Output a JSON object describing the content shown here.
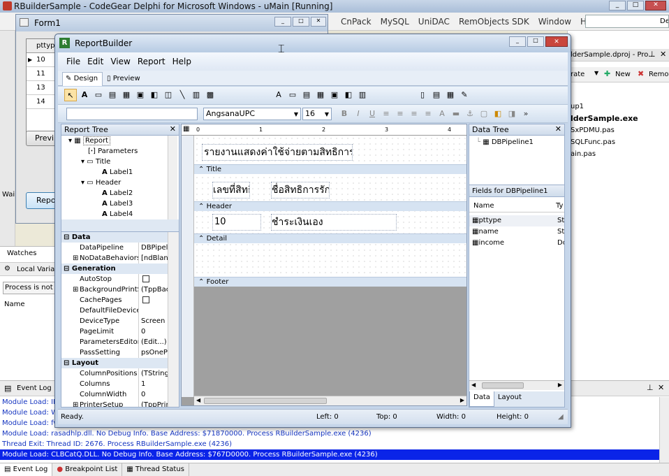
{
  "ide": {
    "title": "RBuilderSample - CodeGear Delphi for Microsoft Windows - uMain [Running]",
    "menu": [
      "CnPack",
      "MySQL",
      "UniDAC",
      "RemObjects SDK",
      "Window",
      "Help"
    ],
    "combo_value": "De",
    "project_title": "lderSample.dproj - Pro...",
    "new_label": "New",
    "remove_label": "Remov",
    "rate_label": "rate",
    "project_files": [
      "up1",
      "lderSample.exe",
      "SxPDMU.pas",
      "SQLFunc.pas",
      "ain.pas"
    ],
    "watches_tab": "Watches",
    "local_vars": "Local Variab",
    "process_msg": "Process is not a",
    "name_col": "Name",
    "event_log_title": "Event Log",
    "event_log": [
      "Module Load: IPH",
      "Module Load: WS",
      "Module Load: fw",
      "Module Load: rasadhlp.dll. No Debug Info. Base Address: $71870000. Process RBuilderSample.exe (4236)",
      "Thread Exit: Thread ID: 2676. Process RBuilderSample.exe (4236)",
      "Module Load: CLBCatQ.DLL. No Debug Info. Base Address: $767D0000. Process RBuilderSample.exe (4236)"
    ],
    "bottom_tabs": [
      "Event Log",
      "Breakpoint List",
      "Thread Status"
    ]
  },
  "form1": {
    "title": "Form1",
    "grid_header": "pttyp",
    "grid_rows": [
      "10",
      "11",
      "13",
      "14"
    ],
    "btn1": "Previ",
    "btn2": "Repo",
    "wait": "Wai"
  },
  "rb": {
    "title": "ReportBuilder",
    "menu": [
      "File",
      "Edit",
      "View",
      "Report",
      "Help"
    ],
    "tabs": [
      "Design",
      "Preview"
    ],
    "font_name": "AngsanaUPC",
    "font_size": "16",
    "report_tree": {
      "title": "Report Tree",
      "items": [
        "Report",
        "Parameters",
        "Title",
        "Label1",
        "Header",
        "Label2",
        "Label3",
        "Label4"
      ]
    },
    "props": [
      {
        "cat": "Data"
      },
      {
        "k": "DataPipeline",
        "v": "DBPipeli"
      },
      {
        "k": "NoDataBehaviors",
        "v": "[ndBlank"
      },
      {
        "cat": "Generation"
      },
      {
        "k": "AutoStop",
        "v": ""
      },
      {
        "k": "BackgroundPrintSe",
        "v": "(TppBac"
      },
      {
        "k": "CachePages",
        "v": ""
      },
      {
        "k": "DefaultFileDeviceT",
        "v": ""
      },
      {
        "k": "DeviceType",
        "v": "Screen"
      },
      {
        "k": "PageLimit",
        "v": "0"
      },
      {
        "k": "ParametersEditor",
        "v": "(Edit...)"
      },
      {
        "k": "PassSetting",
        "v": "psOnePa"
      },
      {
        "cat": "Layout"
      },
      {
        "k": "ColumnPositions",
        "v": "(TString"
      },
      {
        "k": "Columns",
        "v": "1"
      },
      {
        "k": "ColumnWidth",
        "v": "0"
      },
      {
        "k": "PrinterSetup",
        "v": "(TppPrin"
      }
    ],
    "ruler": [
      "0",
      "1",
      "2",
      "3",
      "4"
    ],
    "title_label": "รายงานแสดงค่าใช้จ่ายตามสิทธิการรักษา",
    "header_labels": [
      "เลขที่สิทธิ",
      "ชื่อสิทธิการรักษา"
    ],
    "detail_labels": [
      "10",
      "ชำระเงินเอง"
    ],
    "bands": [
      "Title",
      "Header",
      "Detail",
      "Footer"
    ],
    "data_tree": {
      "title": "Data Tree",
      "pipeline": "DBPipeline1",
      "fields_title": "Fields for DBPipeline1",
      "col_name": "Name",
      "col_type": "Ty",
      "fields": [
        {
          "name": "pttype",
          "type": "St"
        },
        {
          "name": "name",
          "type": "St"
        },
        {
          "name": "income",
          "type": "Do"
        }
      ],
      "tabs": [
        "Data",
        "Layout"
      ]
    },
    "status": {
      "ready": "Ready.",
      "left": "Left: 0",
      "top": "Top: 0",
      "width": "Width: 0",
      "height": "Height: 0"
    }
  }
}
